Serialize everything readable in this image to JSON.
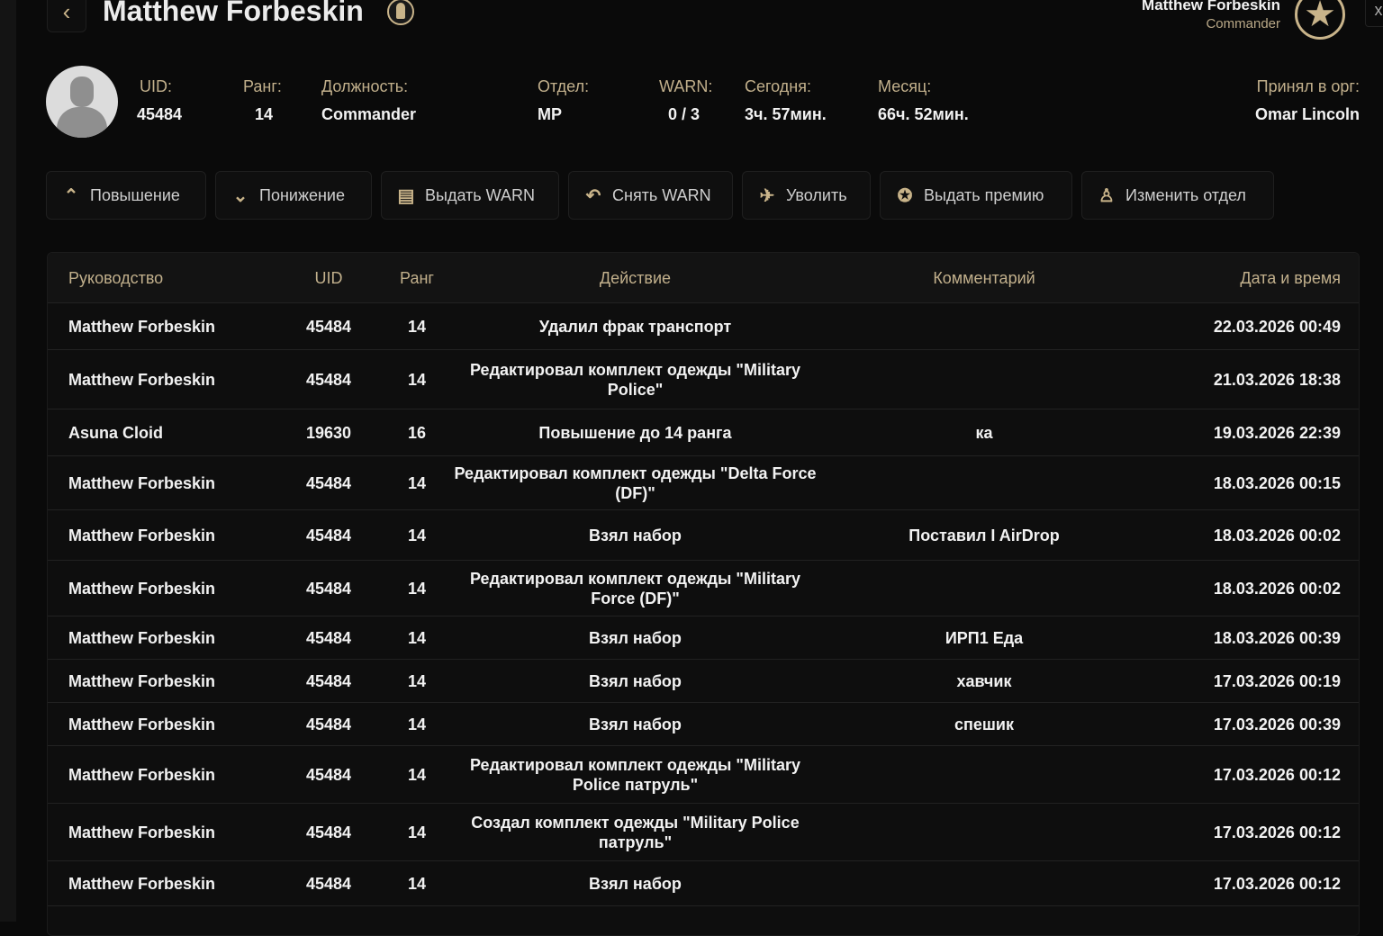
{
  "header": {
    "back_icon": "chevron-left-icon",
    "title": "Matthew Forbeskin",
    "user_name": "Matthew Forbeskin",
    "user_role": "Commander",
    "close_icon": "x"
  },
  "profile": {
    "uid_label": "UID:",
    "uid": "45484",
    "rank_label": "Ранг:",
    "rank": "14",
    "position_label": "Должность:",
    "position": "Commander",
    "dept_label": "Отдел:",
    "dept": "MP",
    "warn_label": "WARN:",
    "warn": "0 / 3",
    "today_label": "Сегодня:",
    "today": "3ч. 57мин.",
    "month_label": "Месяц:",
    "month": "66ч. 52мин.",
    "accepted_label": "Принял в орг:",
    "accepted": "Omar Lincoln"
  },
  "actions": [
    {
      "label": "Повышение",
      "icon": "⌃"
    },
    {
      "label": "Понижение",
      "icon": "⌄"
    },
    {
      "label": "Выдать WARN",
      "icon": "▤"
    },
    {
      "label": "Снять WARN",
      "icon": "↶"
    },
    {
      "label": "Уволить",
      "icon": "✈"
    },
    {
      "label": "Выдать премию",
      "icon": "✪"
    },
    {
      "label": "Изменить отдел",
      "icon": "♙"
    }
  ],
  "table": {
    "headers": [
      "Руководство",
      "UID",
      "Ранг",
      "Действие",
      "Комментарий",
      "Дата и время"
    ],
    "rows": [
      [
        "Matthew Forbeskin",
        "45484",
        "14",
        "Удалил фрак транспорт",
        "",
        "22.03.2026 00:49"
      ],
      [
        "Matthew Forbeskin",
        "45484",
        "14",
        "Редактировал комплект одежды \"Military Police\"",
        "",
        "21.03.2026 18:38"
      ],
      [
        "Asuna Cloid",
        "19630",
        "16",
        "Повышение до 14 ранга",
        "ка",
        "19.03.2026 22:39"
      ],
      [
        "Matthew Forbeskin",
        "45484",
        "14",
        "Редактировал комплект одежды \"Delta Force (DF)\"",
        "",
        "18.03.2026 00:15"
      ],
      [
        "Matthew Forbeskin",
        "45484",
        "14",
        "Взял набор",
        "Поставил I AirDrop",
        "18.03.2026 00:02"
      ],
      [
        "Matthew Forbeskin",
        "45484",
        "14",
        "Редактировал комплект одежды \"Military Force (DF)\"",
        "",
        "18.03.2026 00:02"
      ],
      [
        "Matthew Forbeskin",
        "45484",
        "14",
        "Взял набор",
        "ИРП1 Еда",
        "18.03.2026 00:39"
      ],
      [
        "Matthew Forbeskin",
        "45484",
        "14",
        "Взял набор",
        "хавчик",
        "17.03.2026 00:19"
      ],
      [
        "Matthew Forbeskin",
        "45484",
        "14",
        "Взял набор",
        "спешик",
        "17.03.2026 00:39"
      ],
      [
        "Matthew Forbeskin",
        "45484",
        "14",
        "Редактировал комплект одежды \"Military Police патруль\"",
        "",
        "17.03.2026 00:12"
      ],
      [
        "Matthew Forbeskin",
        "45484",
        "14",
        "Создал комплект одежды \"Military Police патруль\"",
        "",
        "17.03.2026 00:12"
      ],
      [
        "Matthew Forbeskin",
        "45484",
        "14",
        "Взял набор",
        "",
        "17.03.2026 00:12"
      ]
    ]
  }
}
